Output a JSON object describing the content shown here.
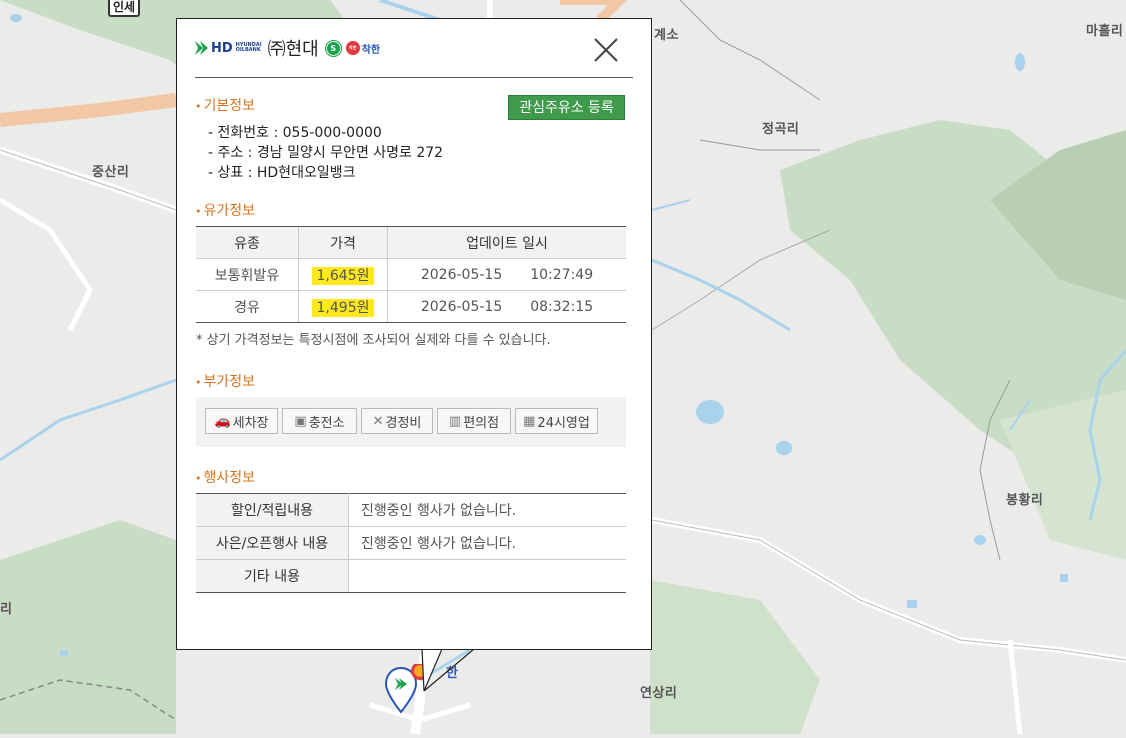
{
  "map": {
    "labels": [
      "중산리",
      "정곡리",
      "봉황리",
      "연상리",
      "마흘리",
      "계소",
      "리",
      "인세",
      "한"
    ]
  },
  "popup": {
    "brand": {
      "logo_text": "HD",
      "sub_line1": "HYUNDAI",
      "sub_line2": "OILBANK",
      "color": "#1a3f8f",
      "arrow_color": "#1aa34a"
    },
    "station_name": "㈜현대",
    "badge_self": "S",
    "badge_kind_label": "착한",
    "badge_kind_mark": "착한",
    "close_icon": "close-x-icon",
    "register_button": "관심주유소 등록",
    "basic": {
      "title": "기본정보",
      "phone": "- 전화번호 : 055-000-0000",
      "address": "- 주소 : 경남 밀양시 무안면 사명로 272",
      "brand": "- 상표 : HD현대오일뱅크"
    },
    "price": {
      "title": "유가정보",
      "headers": [
        "유종",
        "가격",
        "업데이트 일시"
      ],
      "rows": [
        {
          "fuel": "보통휘발유",
          "price": "1,645원",
          "date": "2026-05-15",
          "time": "10:27:49"
        },
        {
          "fuel": "경유",
          "price": "1,495원",
          "date": "2026-05-15",
          "time": "08:32:15"
        }
      ],
      "note": "* 상기 가격정보는 특정시점에 조사되어 실제와 다를 수 있습니다."
    },
    "extras": {
      "title": "부가정보",
      "items": [
        {
          "label": "세차장",
          "icon": "car-wash-icon"
        },
        {
          "label": "충전소",
          "icon": "charging-station-icon"
        },
        {
          "label": "경정비",
          "icon": "wrench-icon"
        },
        {
          "label": "편의점",
          "icon": "store-icon"
        },
        {
          "label": "24시영업",
          "icon": "24h-icon"
        }
      ]
    },
    "events": {
      "title": "행사정보",
      "rows": [
        {
          "key": "할인/적립내용",
          "value": "진행중인 행사가 없습니다."
        },
        {
          "key": "사은/오픈행사 내용",
          "value": "진행중인 행사가 없습니다."
        },
        {
          "key": "기타 내용",
          "value": ""
        }
      ]
    }
  },
  "colors": {
    "accent_orange": "#d9741f",
    "register_green": "#3f9a4b",
    "highlight_yellow": "#ffe81c"
  }
}
